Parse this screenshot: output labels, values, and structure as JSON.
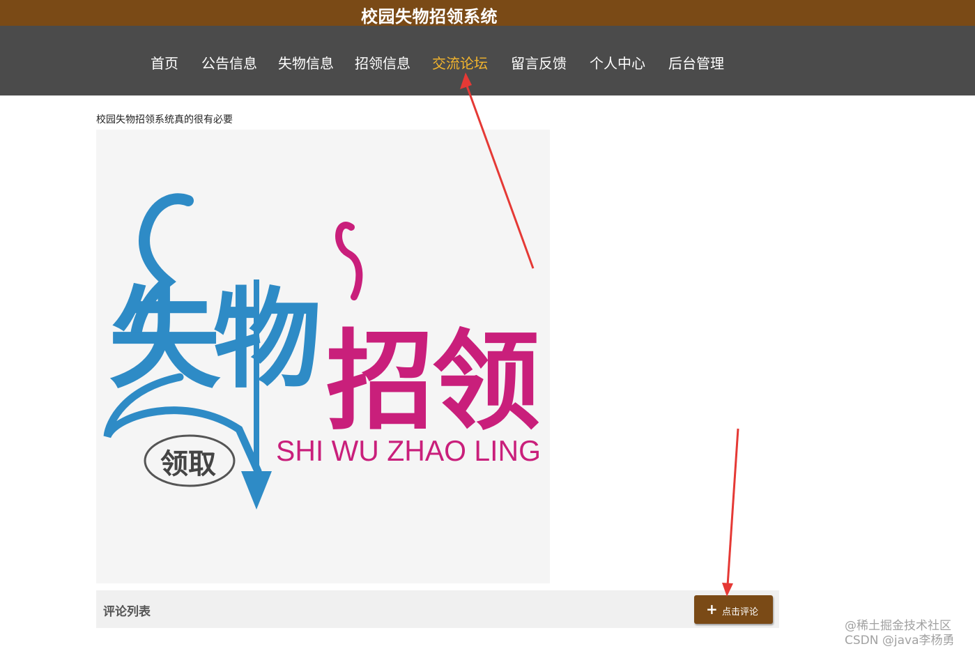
{
  "header": {
    "site_title": "校园失物招领系统"
  },
  "nav": {
    "items": [
      {
        "label": "首页"
      },
      {
        "label": "公告信息"
      },
      {
        "label": "失物信息"
      },
      {
        "label": "招领信息"
      },
      {
        "label": "交流论坛",
        "active": true
      },
      {
        "label": "留言反馈"
      },
      {
        "label": "个人中心"
      },
      {
        "label": "后台管理"
      }
    ]
  },
  "post": {
    "title": "校园失物招领系统真的很有必要",
    "poster": {
      "chars": [
        "失",
        "物",
        "招",
        "领"
      ],
      "subtitle": "SHI WU ZHAO LING",
      "badge": "领取"
    }
  },
  "comments": {
    "list_title": "评论列表",
    "add_button_label": "点击评论"
  },
  "watermark": {
    "line1": "@稀土掘金技术社区",
    "line2": "CSDN @java李杨勇"
  },
  "colors": {
    "title_bar": "#7a4a16",
    "nav_bar": "#4b4b4b",
    "nav_active": "#f3b52d",
    "poster_blue": "#2e8bc6",
    "poster_magenta": "#c91f7b",
    "annotation_red": "#e53935"
  }
}
